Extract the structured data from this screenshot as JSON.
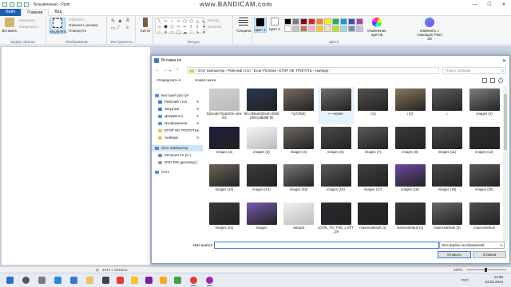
{
  "paint": {
    "title": "Безымянный - Paint",
    "watermark": "www.BANDICAM.com",
    "window_controls": [
      "—",
      "☐",
      "✕"
    ],
    "tabs": [
      "Файл",
      "Главная",
      "Вид"
    ],
    "groups": {
      "clipboard": {
        "label": "Буфер обмена",
        "paste": "Вставить",
        "cut": "Вырезать",
        "copy": "Копировать"
      },
      "image": {
        "label": "Изображение",
        "select": "Выделить",
        "crop": "Обрезать",
        "resize": "Изменить размер",
        "rotate": "Повернуть"
      },
      "tools": {
        "label": "Инструменты"
      },
      "brushes": "Кисти",
      "shapes": {
        "label": "Фигуры",
        "outline": "Контур",
        "fill": "Заливка"
      },
      "size": "Толщина",
      "colors": {
        "label": "Цвета",
        "color1": "Цвет 1",
        "color2": "Цвет 2",
        "edit": "Изменение цветов",
        "paint3d": "Изменить с помощью Paint 3D"
      }
    },
    "palette": [
      "#000000",
      "#7f7f7f",
      "#880015",
      "#ed1c24",
      "#ff7f27",
      "#fff200",
      "#22b14c",
      "#00a2e8",
      "#3f48cc",
      "#a349a4",
      "#ffffff",
      "#c3c3c3",
      "#b97a57",
      "#ffaec9",
      "#ffc90e",
      "#efe4b0",
      "#b5e61d",
      "#99d9ea",
      "#7092be",
      "#c8bfe7"
    ],
    "status": {
      "dimensions": "3472 × 2216пкс",
      "zoom": "100%"
    }
  },
  "dialog": {
    "title": "Вставка из",
    "close": "✕",
    "breadcrumb": "› Этот компьютер › Рабочий стол › Егор+Полина › ЕГОР НЕ ТРОГОТЬ › скибиде",
    "search_placeholder": "Поиск: скибиде",
    "organize": "Упорядочить ▾",
    "new_folder": "Новая папка",
    "nav": [
      {
        "label": "Быстрый доступ",
        "color": "#4a8fe0"
      },
      {
        "label": "Рабочий стол",
        "color": "#3b7ad9"
      },
      {
        "label": "Загрузки",
        "color": "#3b7ad9"
      },
      {
        "label": "Документы",
        "color": "#6b8ec0"
      },
      {
        "label": "Изображения",
        "color": "#4aa0d0"
      },
      {
        "label": "ЕГОР НЕ ТРОГОТЬ",
        "color": "#e8c35d"
      },
      {
        "label": "скибиде",
        "color": "#e8c35d"
      },
      {
        "label": "Этот компьютер",
        "color": "#5a88c8"
      },
      {
        "label": "Windows 10 (C:)",
        "color": "#6b8ec0"
      },
      {
        "label": "DVD RW дисковод (",
        "color": "#9aa0a8"
      },
      {
        "label": "Сеть",
        "color": "#4a8fe0"
      }
    ],
    "files": [
      {
        "name": "Episode70partSm oment1",
        "color": "#cfcfcf"
      },
      {
        "name": "f8cc4f9ea032eeb 068523fe14db88f 90",
        "color": "#2a3650"
      },
      {
        "name": "hq720(9)",
        "color": "#7a6a62"
      },
      {
        "name": "i----копия",
        "color": "#6e6e6e"
      },
      {
        "name": "i (1)",
        "color": "#55524c"
      },
      {
        "name": "i (2)",
        "color": "#8a7a5e"
      },
      {
        "name": "i",
        "color": "#5c5c5c"
      },
      {
        "name": "images (1)",
        "color": "#7a8085"
      },
      {
        "name": "images (2)",
        "color": "#1c1c3c"
      },
      {
        "name": "images (3)",
        "color": "#f4f4f4"
      },
      {
        "name": "images (4)",
        "color": "#6e6a60"
      },
      {
        "name": "images (6)",
        "color": "#4a4a4a"
      },
      {
        "name": "images (7)",
        "color": "#5a5a5a"
      },
      {
        "name": "images (8)",
        "color": "#3a3a3a"
      },
      {
        "name": "images (11)",
        "color": "#4c4a48"
      },
      {
        "name": "images (12)",
        "color": "#2e2e2e"
      },
      {
        "name": "images (13)",
        "color": "#6a6558"
      },
      {
        "name": "images (14)",
        "color": "#3c3c3c"
      },
      {
        "name": "images (15)",
        "color": "#7a7a78"
      },
      {
        "name": "images (16)",
        "color": "#5a5a5a"
      },
      {
        "name": "images (17)",
        "color": "#3e3e3e"
      },
      {
        "name": "images (18)",
        "color": "#6a4aa0"
      },
      {
        "name": "images (19)",
        "color": "#4a4a48"
      },
      {
        "name": "images (20)",
        "color": "#5c5a58"
      },
      {
        "name": "images (21)",
        "color": "#3a3a3a"
      },
      {
        "name": "images",
        "color": "#7a5ab0"
      },
      {
        "name": "Jetpack",
        "color": "#f2f2f2"
      },
      {
        "name": "LOOK_TO_THE_L EFT_29",
        "color": "#2a2a30"
      },
      {
        "name": "maxresdefault (1)",
        "color": "#2a2a2a"
      },
      {
        "name": "maxresdefault (2)",
        "color": "#3c3c3c"
      },
      {
        "name": "maxresdefault (3)",
        "color": "#6a6a68"
      },
      {
        "name": "maxresdefault",
        "color": "#505050"
      }
    ],
    "file_name_label": "Имя файла:",
    "file_name_value": "",
    "file_type": "Все файлы изображений",
    "open": "Открыть",
    "cancel": "Отмена"
  },
  "tray": {
    "lang": "РУС",
    "time": "14:55",
    "date": "23.04.2024"
  }
}
